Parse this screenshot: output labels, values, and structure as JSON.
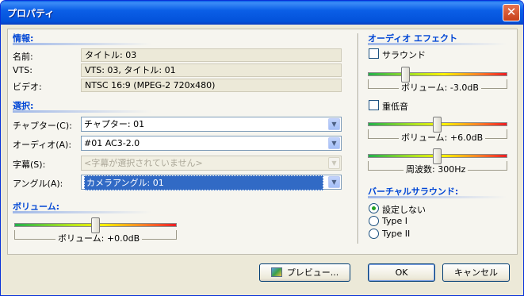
{
  "window": {
    "title": "プロパティ",
    "close_glyph": "✕"
  },
  "info": {
    "title": "情報:",
    "rows": [
      {
        "label": "名前:",
        "value": "タイトル: 03"
      },
      {
        "label": "VTS:",
        "value": "VTS: 03, タイトル: 01"
      },
      {
        "label": "ビデオ:",
        "value": "NTSC 16:9 (MPEG-2 720x480)"
      }
    ]
  },
  "selection": {
    "title": "選択:",
    "rows": [
      {
        "label": "チャプター(C):",
        "value": "チャプター: 01",
        "state": "normal"
      },
      {
        "label": "オーディオ(A):",
        "value": "#01 AC3-2.0",
        "state": "normal"
      },
      {
        "label": "字幕(S):",
        "value": "<字幕が選択されていません>",
        "state": "disabled"
      },
      {
        "label": "アングル(A):",
        "value": "カメラアングル: 01",
        "state": "selected"
      }
    ]
  },
  "volume": {
    "title": "ボリューム:",
    "label": "ボリューム: +0.0dB",
    "level_db": 0.0,
    "position": 0.5
  },
  "audio_effect": {
    "title": "オーディオ エフェクト",
    "surround": {
      "label": "サラウンド",
      "checked": false,
      "slider_label": "ボリューム: -3.0dB",
      "position": 0.27
    },
    "bass": {
      "label": "重低音",
      "checked": false,
      "volume_label": "ボリューム: +6.0dB",
      "volume_position": 0.5,
      "freq_label": "周波数: 300Hz",
      "freq_position": 0.5
    }
  },
  "virtual_surround": {
    "title": "バーチャルサラウンド:",
    "options": [
      {
        "label": "設定しない",
        "checked": true
      },
      {
        "label": "Type I",
        "checked": false
      },
      {
        "label": "Type II",
        "checked": false
      }
    ]
  },
  "buttons": {
    "preview": "プレビュー...",
    "ok": "OK",
    "cancel": "キャンセル"
  },
  "colors": {
    "section_title": "#0046d5",
    "selection_highlight": "#316ac5",
    "titlebar": "#0351d9"
  }
}
